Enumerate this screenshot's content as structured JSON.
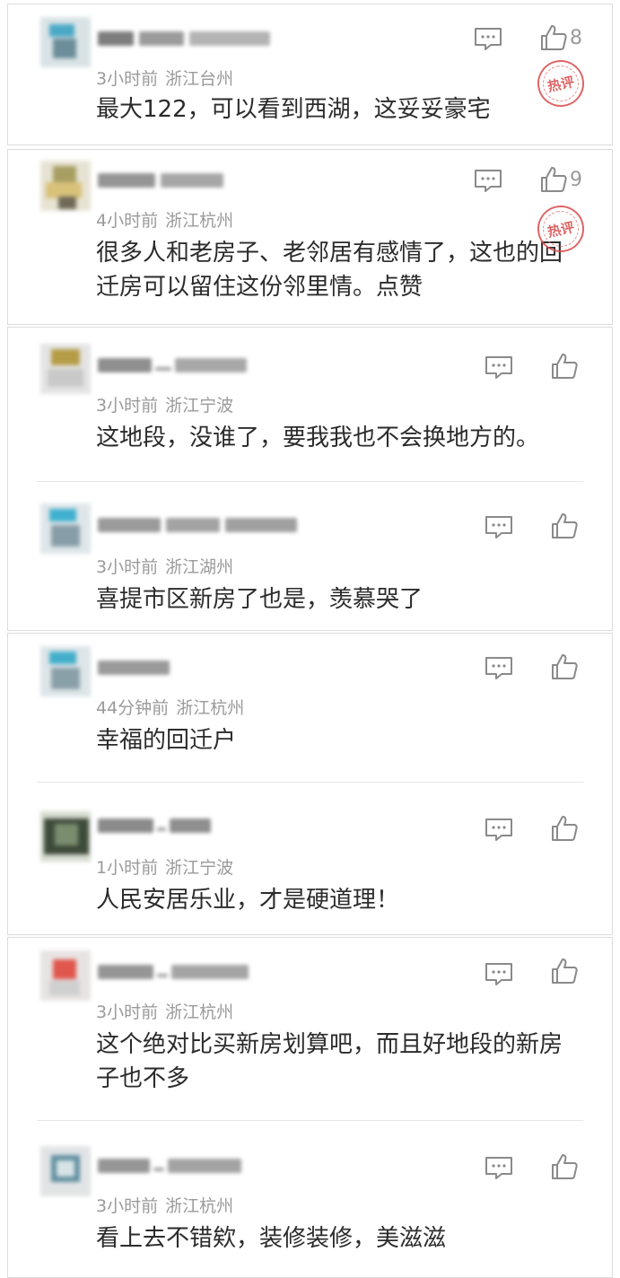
{
  "comments": [
    {
      "time": "3小时前",
      "location": "浙江台州",
      "text": "最大122，可以看到西湖，这妥妥豪宅",
      "likes": "8",
      "hot": true
    },
    {
      "time": "4小时前",
      "location": "浙江杭州",
      "text": "很多人和老房子、老邻居有感情了，这也的回迁房可以留住这份邻里情。点赞",
      "likes": "9",
      "hot": true
    },
    {
      "time": "3小时前",
      "location": "浙江宁波",
      "text": "这地段，没谁了，要我我也不会换地方的。",
      "likes": "",
      "hot": false
    },
    {
      "time": "3小时前",
      "location": "浙江湖州",
      "text": "喜提市区新房了也是，羡慕哭了",
      "likes": "",
      "hot": false
    },
    {
      "time": "44分钟前",
      "location": "浙江杭州",
      "text": "幸福的回迁户",
      "likes": "",
      "hot": false
    },
    {
      "time": "1小时前",
      "location": "浙江宁波",
      "text": "人民安居乐业，才是硬道理！",
      "likes": "",
      "hot": false
    },
    {
      "time": "3小时前",
      "location": "浙江杭州",
      "text": "这个绝对比买新房划算吧，而且好地段的新房子也不多",
      "likes": "",
      "hot": false
    },
    {
      "time": "3小时前",
      "location": "浙江杭州",
      "text": "看上去不错欸，装修装修，美滋滋",
      "likes": "",
      "hot": false
    }
  ],
  "hot_badge_label": "热评",
  "icons": {
    "reply": "comment-reply-icon",
    "like": "thumbs-up-icon"
  },
  "colors": {
    "meta": "#9a9a9a",
    "text": "#2b2b2b",
    "hot_badge": "#d84b4b",
    "icon": "#8a8a8a"
  }
}
